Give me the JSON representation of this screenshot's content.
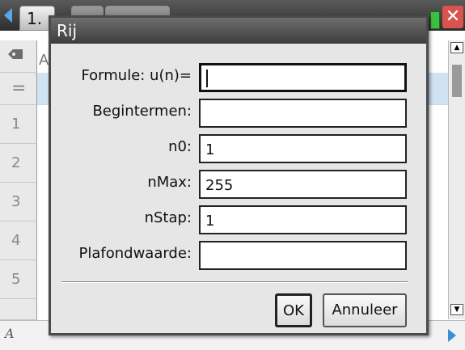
{
  "tabs": [
    {
      "label": "1."
    },
    {
      "label": ""
    },
    {
      "label": ""
    }
  ],
  "sheet": {
    "column_label": "A",
    "row_numbers": [
      "1",
      "2",
      "3",
      "4",
      "5"
    ],
    "formula_row_symbol": "="
  },
  "dialog": {
    "title": "Rij",
    "fields": [
      {
        "label": "Formule: u(n)=",
        "value": ""
      },
      {
        "label": "Begintermen:",
        "value": ""
      },
      {
        "label": "n0:",
        "value": "1"
      },
      {
        "label": "nMax:",
        "value": "255"
      },
      {
        "label": "nStap:",
        "value": "1"
      },
      {
        "label": "Plafondwaarde:",
        "value": ""
      }
    ],
    "ok_label": "OK",
    "cancel_label": "Annuleer"
  },
  "bottom": {
    "label": "A"
  },
  "icons": {
    "tab_left": "arrow-left-icon",
    "battery": "battery-icon",
    "close": "close-icon",
    "tag": "tag-icon",
    "scroll_up": "scroll-up-icon",
    "scroll_down": "scroll-down-icon",
    "next": "arrow-right-icon"
  },
  "colors": {
    "accent": "#3a8fd6",
    "close": "#d9534f",
    "battery": "#3fbf3f"
  }
}
